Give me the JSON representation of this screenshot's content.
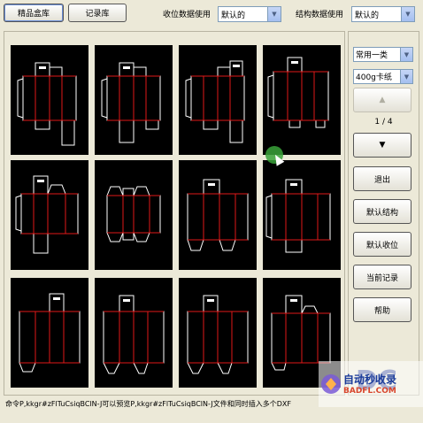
{
  "toolbar": {
    "tab_boutique": "精品盒库",
    "tab_records": "记录库",
    "receive_label": "收位数据使用",
    "receive_value": "默认的",
    "structure_label": "结构数据使用",
    "structure_value": "默认的"
  },
  "side": {
    "category_value": "常用一类",
    "material_value": "400g卡纸",
    "page_indicator": "1 / 4",
    "up_label": "▲",
    "down_label": "▼",
    "exit_label": "退出",
    "default_structure_label": "默认结构",
    "default_receive_label": "默认收位",
    "current_record_label": "当前记录",
    "help_label": "帮助"
  },
  "status": {
    "text": "命令P,kkgr#zFlTuCsiqBClN-J可以预览P,kkgr#zFlTuCsiqBClN-J文件和同时插入多个DXF"
  },
  "thumbnails": [
    {
      "name": "box-1"
    },
    {
      "name": "box-2"
    },
    {
      "name": "box-3"
    },
    {
      "name": "box-4"
    },
    {
      "name": "box-5"
    },
    {
      "name": "box-6"
    },
    {
      "name": "box-7"
    },
    {
      "name": "box-8"
    },
    {
      "name": "box-9"
    },
    {
      "name": "box-10"
    },
    {
      "name": "box-11"
    },
    {
      "name": "box-12"
    }
  ],
  "watermark": {
    "text": "自动秒收录",
    "url": "BADFL.COM"
  },
  "colors": {
    "outline": "#ffffff",
    "fold": "#e01818",
    "accent": "#1a3b9a"
  }
}
